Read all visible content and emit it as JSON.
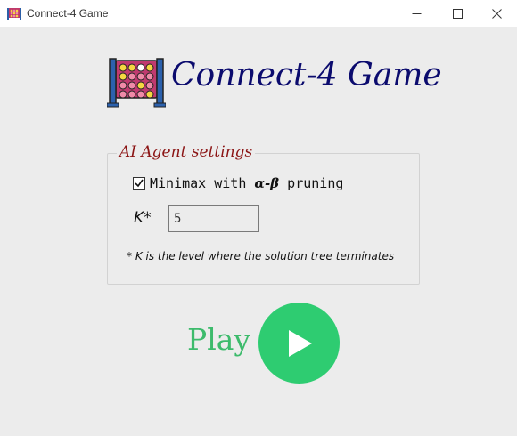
{
  "window": {
    "title": "Connect-4 Game"
  },
  "header": {
    "title": "Connect-4 Game"
  },
  "settings": {
    "legend": "AI Agent settings",
    "minimax_label_prefix": "Minimax with ",
    "minimax_label_greek": "α-β",
    "minimax_label_suffix": " pruning",
    "minimax_checked": true,
    "k_label": "K*",
    "k_value": "5",
    "note": "* K is the level where the solution tree terminates"
  },
  "play": {
    "label": "Play"
  },
  "colors": {
    "heading": "#0b0b6e",
    "legend": "#8b1414",
    "play_green": "#2ecc71",
    "play_label": "#3dbb6c"
  }
}
